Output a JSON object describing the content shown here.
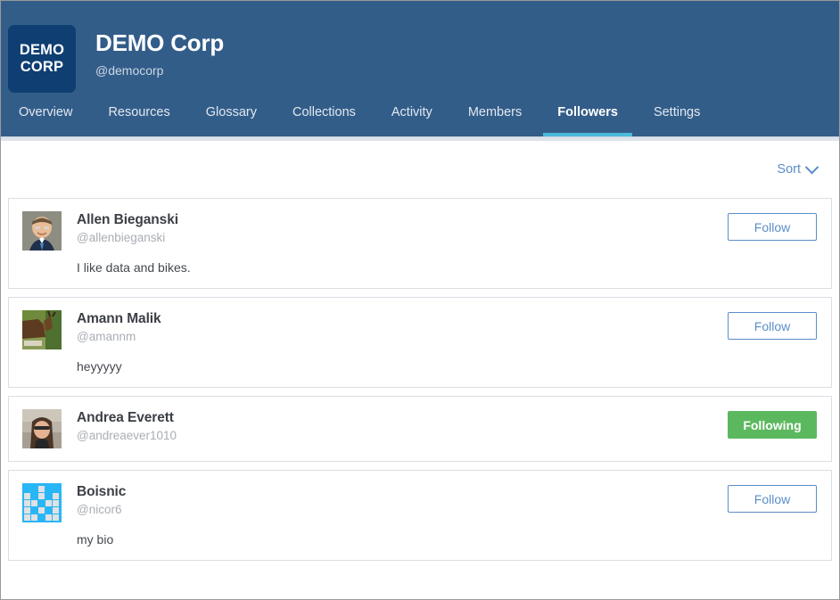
{
  "header": {
    "logo_line1": "DEMO",
    "logo_line2": "CORP",
    "org_name": "DEMO Corp",
    "org_handle": "@democorp",
    "background_color": "#335d89",
    "logo_color": "#0f3e72"
  },
  "nav": {
    "active_tab": "Followers",
    "active_underline_color": "#4ab9d9",
    "tabs": [
      {
        "label": "Overview",
        "active": false
      },
      {
        "label": "Resources",
        "active": false
      },
      {
        "label": "Glossary",
        "active": false
      },
      {
        "label": "Collections",
        "active": false
      },
      {
        "label": "Activity",
        "active": false
      },
      {
        "label": "Members",
        "active": false
      },
      {
        "label": "Followers",
        "active": true
      },
      {
        "label": "Settings",
        "active": false
      }
    ]
  },
  "toolbar": {
    "sort_label": "Sort",
    "sort_icon": "chevron-down-icon",
    "link_color": "#5b8dc8"
  },
  "buttons": {
    "follow_label": "Follow",
    "following_label": "Following",
    "follow_color": "#5b8dc8",
    "following_color": "#5cb85f"
  },
  "followers": [
    {
      "name": "Allen Bieganski",
      "handle": "@allenbieganski",
      "bio": "I like data and bikes.",
      "avatar_type": "photo-portrait-man",
      "button_label": "Follow",
      "button_state": "follow"
    },
    {
      "name": "Amann Malik",
      "handle": "@amannm",
      "bio": "heyyyyy",
      "avatar_type": "photo-deer",
      "button_label": "Follow",
      "button_state": "follow"
    },
    {
      "name": "Andrea Everett",
      "handle": "@andreaever1010",
      "bio": "",
      "avatar_type": "photo-portrait-woman",
      "button_label": "Following",
      "button_state": "following"
    },
    {
      "name": "Boisnic",
      "handle": "@nicor6",
      "bio": "my bio",
      "avatar_type": "identicon-blue",
      "button_label": "Follow",
      "button_state": "follow"
    }
  ]
}
